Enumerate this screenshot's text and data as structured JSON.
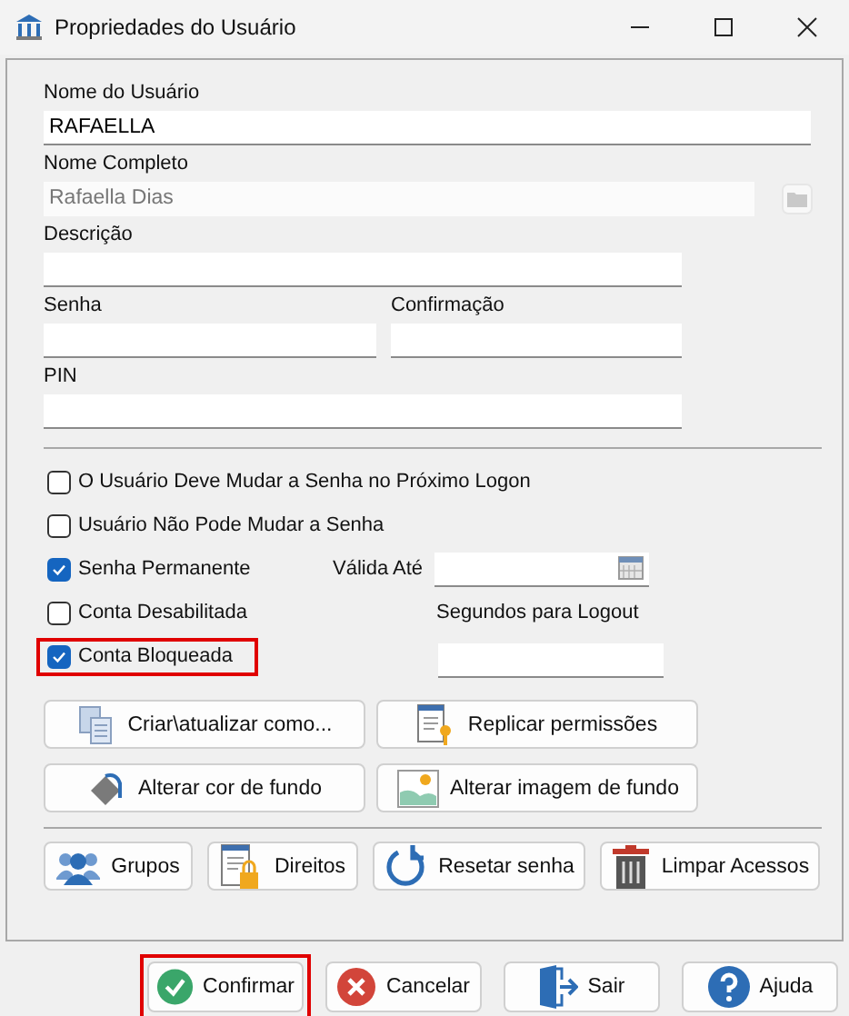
{
  "window": {
    "title": "Propriedades do Usuário"
  },
  "user_name": {
    "label": "Nome do Usuário",
    "value": "RAFAELLA"
  },
  "full_name": {
    "label": "Nome Completo",
    "value": "Rafaella Dias",
    "disabled": true
  },
  "description": {
    "label": "Descrição"
  },
  "password": {
    "label": "Senha"
  },
  "confirmation": {
    "label": "Confirmação"
  },
  "pin": {
    "label": "PIN"
  },
  "options": [
    {
      "label": "O Usuário Deve Mudar a Senha no Próximo Logon",
      "checked": false,
      "highlighted": false
    },
    {
      "label": "Usuário Não Pode Mudar a Senha",
      "checked": false,
      "highlighted": false
    },
    {
      "label": "Senha Permanente",
      "checked": true,
      "highlighted": false
    },
    {
      "label": "Conta Desabilitada",
      "checked": false,
      "highlighted": false
    },
    {
      "label": "Conta Bloqueada",
      "checked": true,
      "highlighted": true
    }
  ],
  "valid_until": {
    "label": "Válida Até"
  },
  "logout_seconds": {
    "label": "Segundos para Logout"
  },
  "actions": [
    {
      "label": "Criar\\atualizar como...",
      "kind": "copy"
    },
    {
      "label": "Replicar permissões",
      "kind": "key"
    },
    {
      "label": "Alterar cor de fundo",
      "kind": "paint"
    },
    {
      "label": "Alterar imagem de fundo",
      "kind": "image"
    }
  ],
  "tools": [
    {
      "label": "Grupos",
      "kind": "groups"
    },
    {
      "label": "Direitos",
      "kind": "lock"
    },
    {
      "label": "Resetar senha",
      "kind": "reset"
    },
    {
      "label": "Limpar Acessos",
      "kind": "trash"
    }
  ],
  "footer_buttons": [
    {
      "label": "Confirmar",
      "kind": "confirm",
      "highlighted": true
    },
    {
      "label": "Cancelar",
      "kind": "cancel",
      "highlighted": false
    },
    {
      "label": "Sair",
      "kind": "exit",
      "highlighted": false
    },
    {
      "label": "Ajuda",
      "kind": "help",
      "highlighted": false
    }
  ]
}
